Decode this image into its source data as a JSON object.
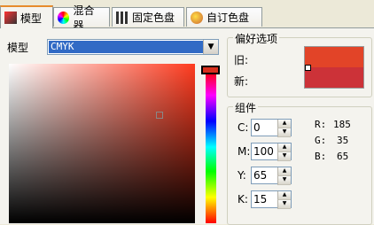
{
  "tabs": [
    {
      "label": "模型",
      "icon": "model-icon"
    },
    {
      "label": "混合器",
      "icon": "mixer-icon"
    },
    {
      "label": "固定色盘",
      "icon": "fixed-palette-icon"
    },
    {
      "label": "自订色盘",
      "icon": "custom-palette-icon"
    }
  ],
  "model": {
    "label": "模型",
    "selected": "CMYK"
  },
  "preferences": {
    "title": "偏好选项",
    "old_label": "旧:",
    "new_label": "新:",
    "old_color": "#e24428",
    "new_color": "#cc3238"
  },
  "components": {
    "title": "组件",
    "fields": [
      {
        "label": "C:",
        "value": "0"
      },
      {
        "label": "M:",
        "value": "100"
      },
      {
        "label": "Y:",
        "value": "65"
      },
      {
        "label": "K:",
        "value": "15"
      }
    ],
    "rgb": [
      {
        "label": "R:",
        "value": "185"
      },
      {
        "label": "G:",
        "value": "35"
      },
      {
        "label": "B:",
        "value": "65"
      }
    ]
  }
}
